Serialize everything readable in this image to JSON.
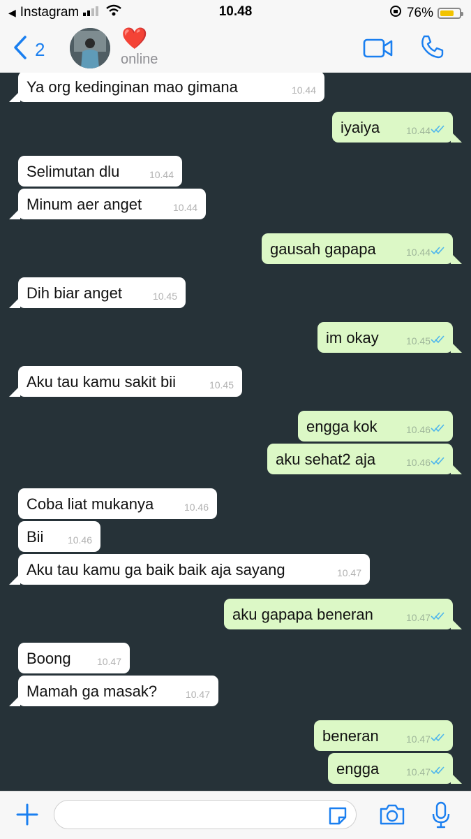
{
  "status_bar": {
    "back_app": "Instagram",
    "time": "10.48",
    "battery_percent": "76%",
    "battery_level": 0.76
  },
  "header": {
    "back_count": "2",
    "contact_name": "❤️",
    "contact_status": "online"
  },
  "messages": [
    {
      "dir": "in",
      "text": "Ya org kedinginan mao gimana",
      "time": "10.44"
    },
    {
      "dir": "out",
      "text": "iyaiya",
      "time": "10.44"
    },
    {
      "dir": "in",
      "text": "Selimutan dlu",
      "time": "10.44"
    },
    {
      "dir": "in",
      "text": "Minum aer anget",
      "time": "10.44"
    },
    {
      "dir": "out",
      "text": "gausah gapapa",
      "time": "10.44"
    },
    {
      "dir": "in",
      "text": "Dih biar anget",
      "time": "10.45"
    },
    {
      "dir": "out",
      "text": "im okay",
      "time": "10.45"
    },
    {
      "dir": "in",
      "text": "Aku tau kamu sakit bii",
      "time": "10.45"
    },
    {
      "dir": "out",
      "text": "engga kok",
      "time": "10.46"
    },
    {
      "dir": "out",
      "text": "aku sehat2 aja",
      "time": "10.46"
    },
    {
      "dir": "in",
      "text": "Coba liat mukanya",
      "time": "10.46"
    },
    {
      "dir": "in",
      "text": "Bii",
      "time": "10.46"
    },
    {
      "dir": "in",
      "text": "Aku tau kamu ga baik baik aja sayang",
      "time": "10.47"
    },
    {
      "dir": "out",
      "text": "aku gapapa beneran",
      "time": "10.47"
    },
    {
      "dir": "in",
      "text": "Boong",
      "time": "10.47"
    },
    {
      "dir": "in",
      "text": "Mamah ga masak?",
      "time": "10.47"
    },
    {
      "dir": "out",
      "text": "beneran",
      "time": "10.47"
    },
    {
      "dir": "out",
      "text": "engga",
      "time": "10.47"
    }
  ],
  "input": {
    "value": "",
    "placeholder": ""
  },
  "icons": {
    "back": "chevron-left-icon",
    "video": "video-call-icon",
    "phone": "phone-icon",
    "attach": "plus-icon",
    "sticker": "sticker-icon",
    "camera": "camera-icon",
    "mic": "microphone-icon",
    "read": "double-check-icon"
  },
  "colors": {
    "accent": "#1a7ff0",
    "chat_background": "#263238",
    "incoming_bubble": "#ffffff",
    "outgoing_bubble": "#dcf8c6",
    "read_ticks": "#4fb6ec"
  }
}
